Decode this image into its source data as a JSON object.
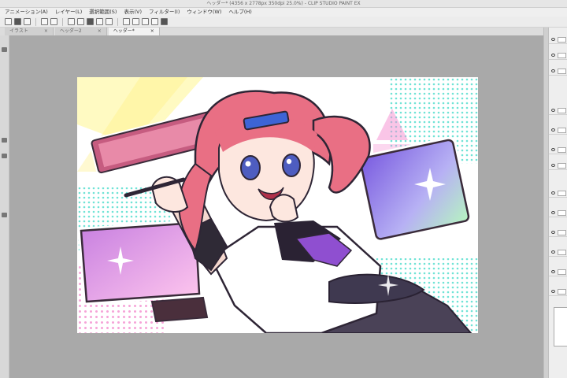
{
  "window": {
    "title": "ヘッダー* (4356 x 2778px 350dpi 25.0%) - CLIP STUDIO PAINT EX"
  },
  "menu": [
    "アニメーション(A)",
    "レイヤー(L)",
    "選択範囲(S)",
    "表示(V)",
    "フィルター(I)",
    "ウィンドウ(W)",
    "ヘルプ(H)"
  ],
  "tabs": [
    {
      "label": "イラスト"
    },
    {
      "label": "ヘッダー2"
    },
    {
      "label": "ヘッダー*"
    }
  ],
  "icons": [
    "file-new-icon",
    "open-icon",
    "save-icon",
    "undo-icon",
    "redo-icon",
    "select-icon",
    "transform-icon",
    "fill-icon",
    "ruler-icon",
    "grid-icon"
  ],
  "colors": {
    "accent": "#e87a86",
    "canvas": "#ffffff",
    "workspace": "#a9a9a9"
  }
}
